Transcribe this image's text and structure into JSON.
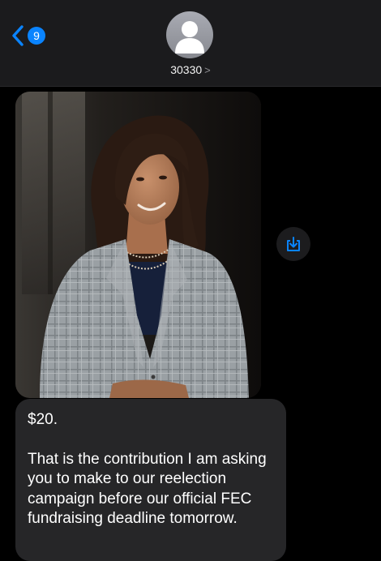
{
  "header": {
    "back_badge": "9",
    "contact_name": "30330",
    "contact_chevron": ">"
  },
  "icons": {
    "back": "chevron-left-icon",
    "avatar": "person-silhouette-icon",
    "save": "save-to-photos-icon"
  },
  "colors": {
    "accent": "#0a84ff",
    "header_bg": "#1b1b1d",
    "bubble_bg": "#262628",
    "background": "#000000"
  },
  "messages": [
    {
      "type": "image",
      "subject": "photo of a smiling woman in a gray plaid blazer"
    },
    {
      "type": "text",
      "line1": "$20.",
      "line2": "That is the contribution I am asking you to make to our reelection campaign before our official FEC fundraising deadline tomorrow."
    }
  ]
}
